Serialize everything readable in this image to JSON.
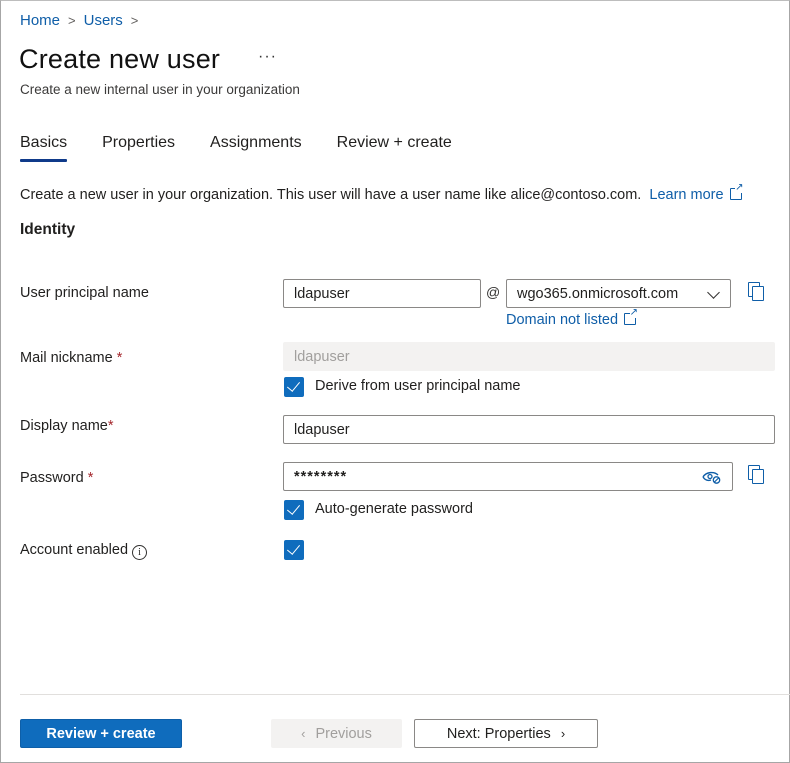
{
  "breadcrumb": [
    {
      "label": "Home"
    },
    {
      "label": "Users"
    }
  ],
  "header": {
    "title": "Create new user",
    "more_label": "···",
    "subtitle": "Create a new internal user in your organization"
  },
  "tabs": [
    {
      "label": "Basics",
      "active": true
    },
    {
      "label": "Properties",
      "active": false
    },
    {
      "label": "Assignments",
      "active": false
    },
    {
      "label": "Review + create",
      "active": false
    }
  ],
  "description": {
    "text": "Create a new user in your organization. This user will have a user name like alice@contoso.com.",
    "link_label": "Learn more"
  },
  "section_title": "Identity",
  "form": {
    "upn": {
      "label": "User principal name",
      "value": "ldapuser",
      "at_symbol": "@",
      "domain_value": "wgo365.onmicrosoft.com",
      "domain_link": "Domain not listed"
    },
    "mail_nickname": {
      "label": "Mail nickname",
      "required_mark": "*",
      "value": "ldapuser",
      "derive_checkbox_label": "Derive from user principal name",
      "derive_checked": true
    },
    "display_name": {
      "label": "Display name",
      "required_mark": "*",
      "value": "ldapuser"
    },
    "password": {
      "label": "Password",
      "required_mark": "*",
      "value": "********",
      "autogen_checkbox_label": "Auto-generate password",
      "autogen_checked": true
    },
    "account_enabled": {
      "label": "Account enabled",
      "info_glyph": "i",
      "checked": true
    }
  },
  "footer": {
    "review_create_label": "Review + create",
    "previous_label": "Previous",
    "next_label": "Next: Properties",
    "prev_chevron": "‹",
    "next_chevron": "›"
  },
  "colors": {
    "accent": "#0f6cbd",
    "link": "#0f5ea8",
    "required": "#a4262c"
  }
}
